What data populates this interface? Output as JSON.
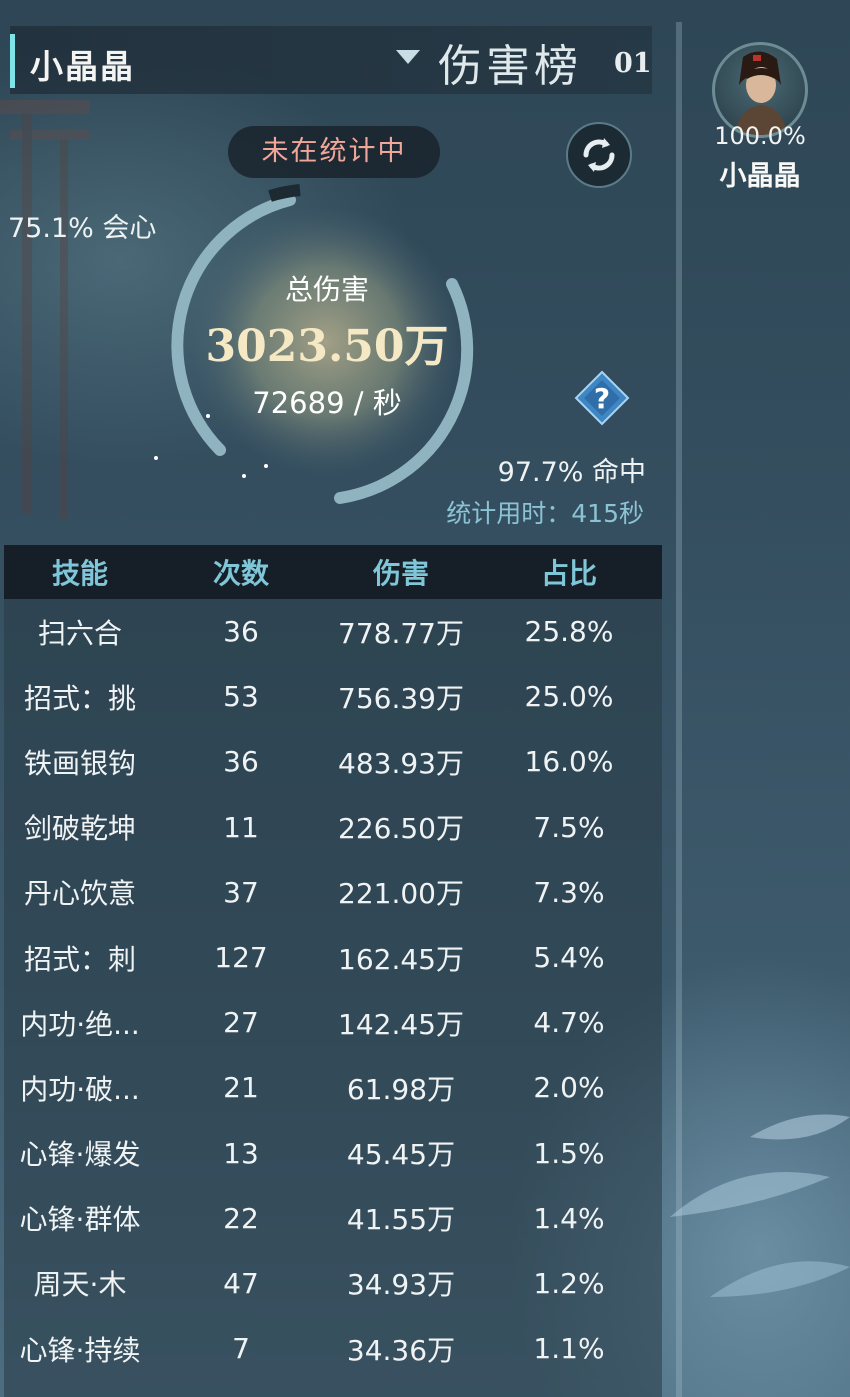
{
  "header": {
    "player_name": "小晶晶",
    "board_title": "伤害榜",
    "board_index": "01"
  },
  "status": {
    "not_counting": "未在统计中"
  },
  "stats": {
    "crit_text": "75.1% 会心",
    "total_label": "总伤害",
    "total_value": "3023.50万",
    "dps_text": "72689 / 秒",
    "hit_text": "97.7% 命中",
    "duration_text": "统计用时：415秒"
  },
  "sidebar": {
    "avatar_percent": "100.0%",
    "avatar_name": "小晶晶"
  },
  "icons": {
    "refresh": "refresh-icon",
    "help": "question-diamond-icon",
    "dropdown": "triangle-down-icon"
  },
  "colors": {
    "accent_cyan": "#7fe4e8",
    "status_red": "#f0a79a",
    "header_text": "#7fc6d8",
    "duration_blue": "#8cc3d4"
  },
  "table": {
    "headers": [
      "技能",
      "次数",
      "伤害",
      "占比"
    ],
    "rows": [
      [
        "扫六合",
        "36",
        "778.77万",
        "25.8%"
      ],
      [
        "招式：挑",
        "53",
        "756.39万",
        "25.0%"
      ],
      [
        "铁画银钩",
        "36",
        "483.93万",
        "16.0%"
      ],
      [
        "剑破乾坤",
        "11",
        "226.50万",
        "7.5%"
      ],
      [
        "丹心饮意",
        "37",
        "221.00万",
        "7.3%"
      ],
      [
        "招式：刺",
        "127",
        "162.45万",
        "5.4%"
      ],
      [
        "内功·绝...",
        "27",
        "142.45万",
        "4.7%"
      ],
      [
        "内功·破...",
        "21",
        "61.98万",
        "2.0%"
      ],
      [
        "心锋·爆发",
        "13",
        "45.45万",
        "1.5%"
      ],
      [
        "心锋·群体",
        "22",
        "41.55万",
        "1.4%"
      ],
      [
        "周天·木",
        "47",
        "34.93万",
        "1.2%"
      ],
      [
        "心锋·持续",
        "7",
        "34.36万",
        "1.1%"
      ]
    ]
  }
}
